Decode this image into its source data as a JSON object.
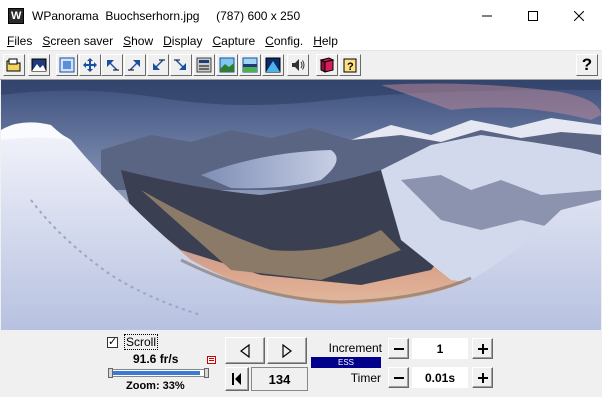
{
  "window": {
    "title": "WPanorama  Buochserhorn.jpg     (787) 600 x 250"
  },
  "menu": [
    {
      "label": "Files",
      "key": "F",
      "rest": "iles"
    },
    {
      "label": "Screen saver",
      "key": "S",
      "rest": "creen saver"
    },
    {
      "label": "Show",
      "key": "S",
      "rest": "how"
    },
    {
      "label": "Display",
      "key": "D",
      "rest": "isplay"
    },
    {
      "label": "Capture",
      "key": "C",
      "rest": "apture"
    },
    {
      "label": "Config.",
      "key": "C",
      "rest": "onfig."
    },
    {
      "label": "Help",
      "key": "H",
      "rest": "elp"
    }
  ],
  "toolbar": {
    "help_glyph": "?"
  },
  "controls": {
    "scroll_label": "Scroll",
    "scroll_checked": true,
    "fps": "91.6 fr/s",
    "zoom": "Zoom: 33%",
    "frame_count": "134",
    "increment_label": "Increment",
    "increment_value": "1",
    "ess_label": "ESS",
    "timer_label": "Timer",
    "timer_value": "0.01s",
    "speed_fraction": 0.95
  },
  "colors": {
    "accent": "#00008b",
    "slider_fill": "#3a7bd5"
  }
}
